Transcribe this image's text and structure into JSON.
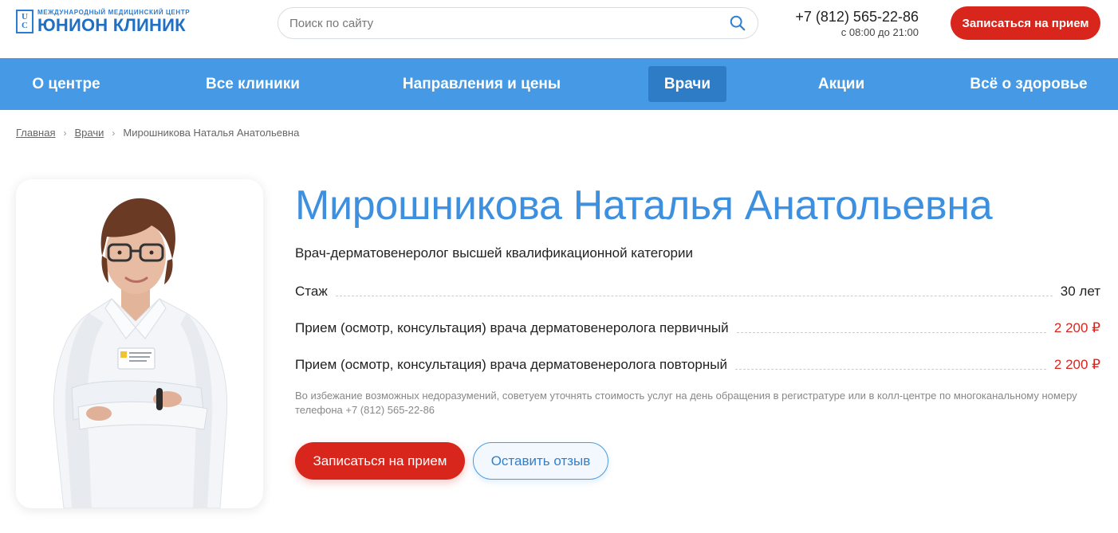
{
  "header": {
    "logo_small": "МЕЖДУНАРОДНЫЙ МЕДИЦИНСКИЙ ЦЕНТР",
    "logo_big": "ЮНИОН КЛИНИК",
    "logo_mark_top": "U",
    "logo_mark_bottom": "C",
    "search_placeholder": "Поиск по сайту",
    "phone": "+7 (812) 565-22-86",
    "hours": "с 08:00 до 21:00",
    "cta_label": "Записаться на прием"
  },
  "nav": {
    "items": [
      {
        "label": "О центре"
      },
      {
        "label": "Все клиники"
      },
      {
        "label": "Направления и цены"
      },
      {
        "label": "Врачи"
      },
      {
        "label": "Акции"
      },
      {
        "label": "Всё о здоровье"
      }
    ]
  },
  "breadcrumb": {
    "home": "Главная",
    "doctors": "Врачи",
    "current": "Мирошникова Наталья Анатольевна"
  },
  "doctor": {
    "name": "Мирошникова Наталья Анатольевна",
    "position": "Врач-дерматовенеролог высшей квалификационной категории",
    "experience_label": "Стаж",
    "experience_value": "30 лет",
    "services": [
      {
        "label": "Прием (осмотр, консультация) врача дерматовенеролога первичный",
        "price": "2 200 ₽"
      },
      {
        "label": "Прием (осмотр, консультация) врача дерматовенеролога повторный",
        "price": "2 200 ₽"
      }
    ],
    "note": "Во избежание возможных недоразумений, советуем уточнять стоимость услуг на день обращения в регистратуре или в колл-центре по многоканальному номеру телефона +7 (812) 565-22-86",
    "cta_primary": "Записаться на прием",
    "cta_secondary": "Оставить отзыв"
  },
  "colors": {
    "accent_blue": "#4699e4",
    "nav_active": "#2e7cc5",
    "brand_red": "#d9261c",
    "title_blue": "#3d8fe0"
  }
}
